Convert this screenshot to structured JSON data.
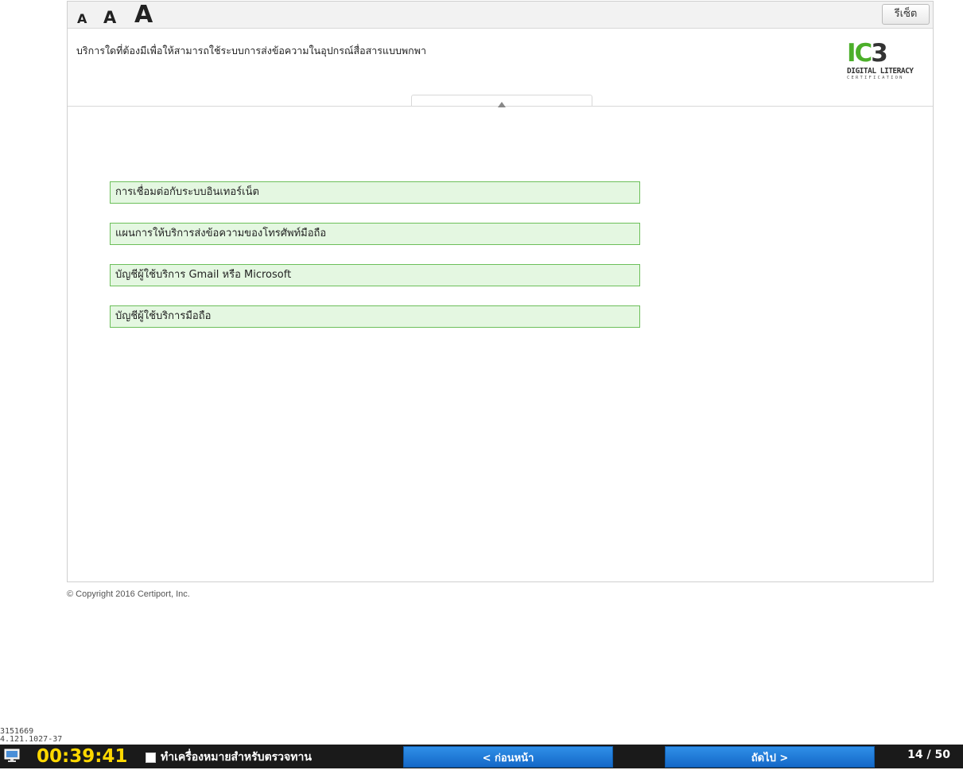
{
  "toolbar": {
    "font_small": "A",
    "font_medium": "A",
    "font_large": "A",
    "reset_label": "รีเซ็ต"
  },
  "question": {
    "text": "บริการใดที่ต้องมีเพื่อให้สามารถใช้ระบบการส่งข้อความในอุปกรณ์สื่อสารแบบพกพา"
  },
  "logo": {
    "ic": "IC",
    "three": "3",
    "line1": "DIGITAL LITERACY",
    "line2": "CERTIFICATION"
  },
  "answers": [
    "การเชื่อมต่อกับระบบอินเทอร์เน็ต",
    "แผนการให้บริการส่งข้อความของโทรศัพท์มือถือ",
    "บัญชีผู้ใช้บริการ Gmail หรือ Microsoft",
    "บัญชีผู้ใช้บริการมือถือ"
  ],
  "footer": {
    "copyright": "© Copyright 2016 Certiport, Inc."
  },
  "ids": {
    "line1": "3151669",
    "line2": "4.121.1027-37"
  },
  "bottombar": {
    "timer": "00:39:41",
    "mark_review": "ทำเครื่องหมายสำหรับตรวจทาน",
    "prev_label": "< ก่อนหน้า",
    "next_label": "ถัดไป >",
    "progress": "14 / 50"
  },
  "colors": {
    "answer_bg": "#e4f7e1",
    "answer_border": "#6cbf5a",
    "timer": "#ffd800",
    "nav_button": "#1f7bd9",
    "logo_green": "#4caf2a"
  }
}
